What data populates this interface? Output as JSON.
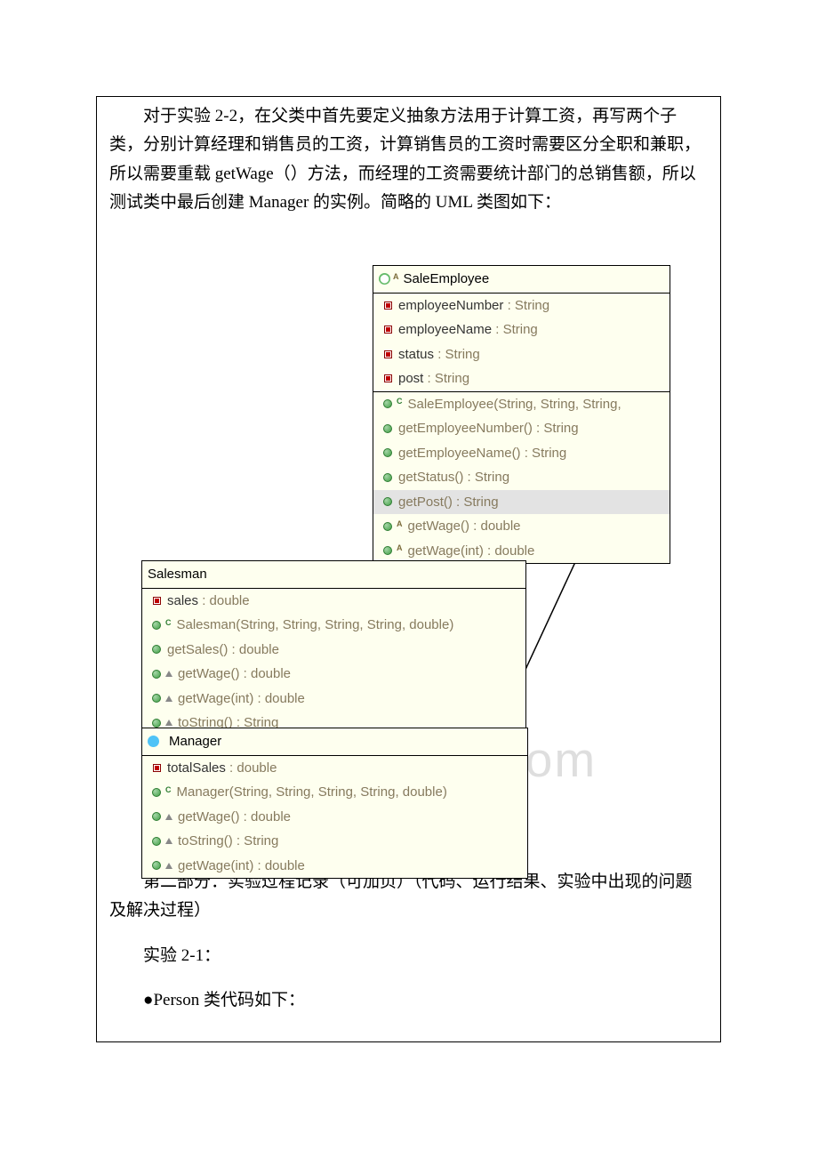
{
  "intro": "对于实验 2-2，在父类中首先要定义抽象方法用于计算工资，再写两个子类，分别计算经理和销售员的工资，计算销售员的工资时需要区分全职和兼职，所以需要重载 getWage（）方法，而经理的工资需要统计部门的总销售额，所以测试类中最后创建 Manager 的实例。简略的 UML 类图如下：",
  "watermark": "www.bdocx.com",
  "uml": {
    "saleEmployee": {
      "name": "SaleEmployee",
      "fields": [
        {
          "name": "employeeNumber",
          "type": "String"
        },
        {
          "name": "employeeName",
          "type": "String"
        },
        {
          "name": "status",
          "type": "String"
        },
        {
          "name": "post",
          "type": "String"
        }
      ],
      "methods": [
        {
          "kind": "constructor",
          "label": "SaleEmployee(String, String, String,"
        },
        {
          "kind": "method",
          "label": "getEmployeeNumber() : String"
        },
        {
          "kind": "method",
          "label": "getEmployeeName() : String"
        },
        {
          "kind": "method",
          "label": "getStatus() : String"
        },
        {
          "kind": "method",
          "label": "getPost() : String",
          "selected": true
        },
        {
          "kind": "abstract",
          "label": "getWage() : double"
        },
        {
          "kind": "abstract",
          "label": "getWage(int) : double"
        }
      ]
    },
    "salesman": {
      "name": "Salesman",
      "fields": [
        {
          "name": "sales",
          "type": "double"
        }
      ],
      "methods": [
        {
          "kind": "constructor",
          "label": "Salesman(String, String, String, String, double)"
        },
        {
          "kind": "method",
          "label": "getSales() : double"
        },
        {
          "kind": "override",
          "label": "getWage() : double"
        },
        {
          "kind": "override",
          "label": "getWage(int) : double"
        },
        {
          "kind": "override",
          "label": "toString() : String"
        }
      ]
    },
    "manager": {
      "name": "Manager",
      "fields": [
        {
          "name": "totalSales",
          "type": "double"
        }
      ],
      "methods": [
        {
          "kind": "constructor",
          "label": "Manager(String, String, String, String, double)"
        },
        {
          "kind": "override",
          "label": "getWage() : double"
        },
        {
          "kind": "override",
          "label": "toString() : String"
        },
        {
          "kind": "override",
          "label": "getWage(int) : double"
        }
      ]
    }
  },
  "part2": {
    "heading": "第二部分：实验过程记录（可加页）（代码、运行结果、实验中出现的问题及解决过程）",
    "sub1": "实验 2-1：",
    "sub2": "●Person 类代码如下："
  }
}
